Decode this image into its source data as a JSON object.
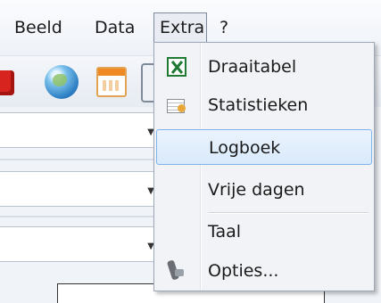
{
  "menubar": {
    "items": [
      "Beeld",
      "Data",
      "Extra",
      "?"
    ]
  },
  "toolbar": {
    "icons": [
      "stop-icon",
      "globe-icon",
      "calendar-icon"
    ]
  },
  "dropdown": {
    "items": [
      {
        "label": "Draaitabel",
        "icon": "excel-icon"
      },
      {
        "label": "Statistieken",
        "icon": "statistics-icon"
      },
      {
        "label": "Logboek",
        "icon": "",
        "highlighted": true
      },
      {
        "label": "Vrije dagen",
        "icon": ""
      },
      {
        "label": "Taal",
        "icon": ""
      },
      {
        "label": "Opties...",
        "icon": "options-icon"
      }
    ]
  },
  "colors": {
    "highlight_bg": "#d9eafb",
    "highlight_border": "#7eb4ea",
    "menu_bg": "#f1f3f6"
  }
}
